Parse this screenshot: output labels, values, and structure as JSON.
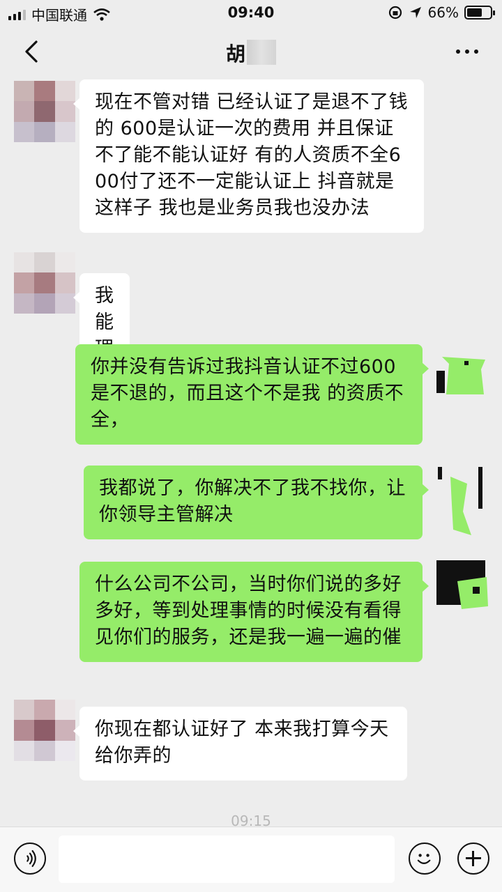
{
  "status_bar": {
    "carrier": "中国联通",
    "time": "09:40",
    "battery_percent": "66%",
    "battery_level": 0.66,
    "icons": [
      "signal-icon",
      "wifi-icon",
      "rotation-lock-icon",
      "location-icon",
      "battery-icon"
    ]
  },
  "header": {
    "title": "胡",
    "icons": [
      "back-icon",
      "more-icon"
    ]
  },
  "messages": [
    {
      "side": "in",
      "text": "现在不管对错 已经认证了是退不了钱的 600是认证一次的费用 并且保证不了能不能认证好 有的人资质不全600付了还不一定能认证上 抖音就是这样子 我也是业务员我也没办法"
    },
    {
      "side": "in",
      "text": "我能理解你"
    },
    {
      "side": "out",
      "text": "你并没有告诉过我抖音认证不过600是不退的，而且这个不是我 的资质不全，"
    },
    {
      "side": "out",
      "text": "我都说了，你解决不了我不找你，让你领导主管解决"
    },
    {
      "side": "out",
      "text": "什么公司不公司，当时你们说的多好多好，等到处理事情的时候没有看得见你们的服务，还是我一遍一遍的催"
    },
    {
      "side": "in",
      "text": "你现在都认证好了 本来我打算今天给你弄的"
    }
  ],
  "timestamp": "09:15",
  "input_bar": {
    "value": "",
    "icons": [
      "voice-icon",
      "emoji-icon",
      "plus-icon"
    ]
  },
  "colors": {
    "background": "#ededed",
    "incoming_bubble": "#ffffff",
    "outgoing_bubble": "#95ec69"
  }
}
